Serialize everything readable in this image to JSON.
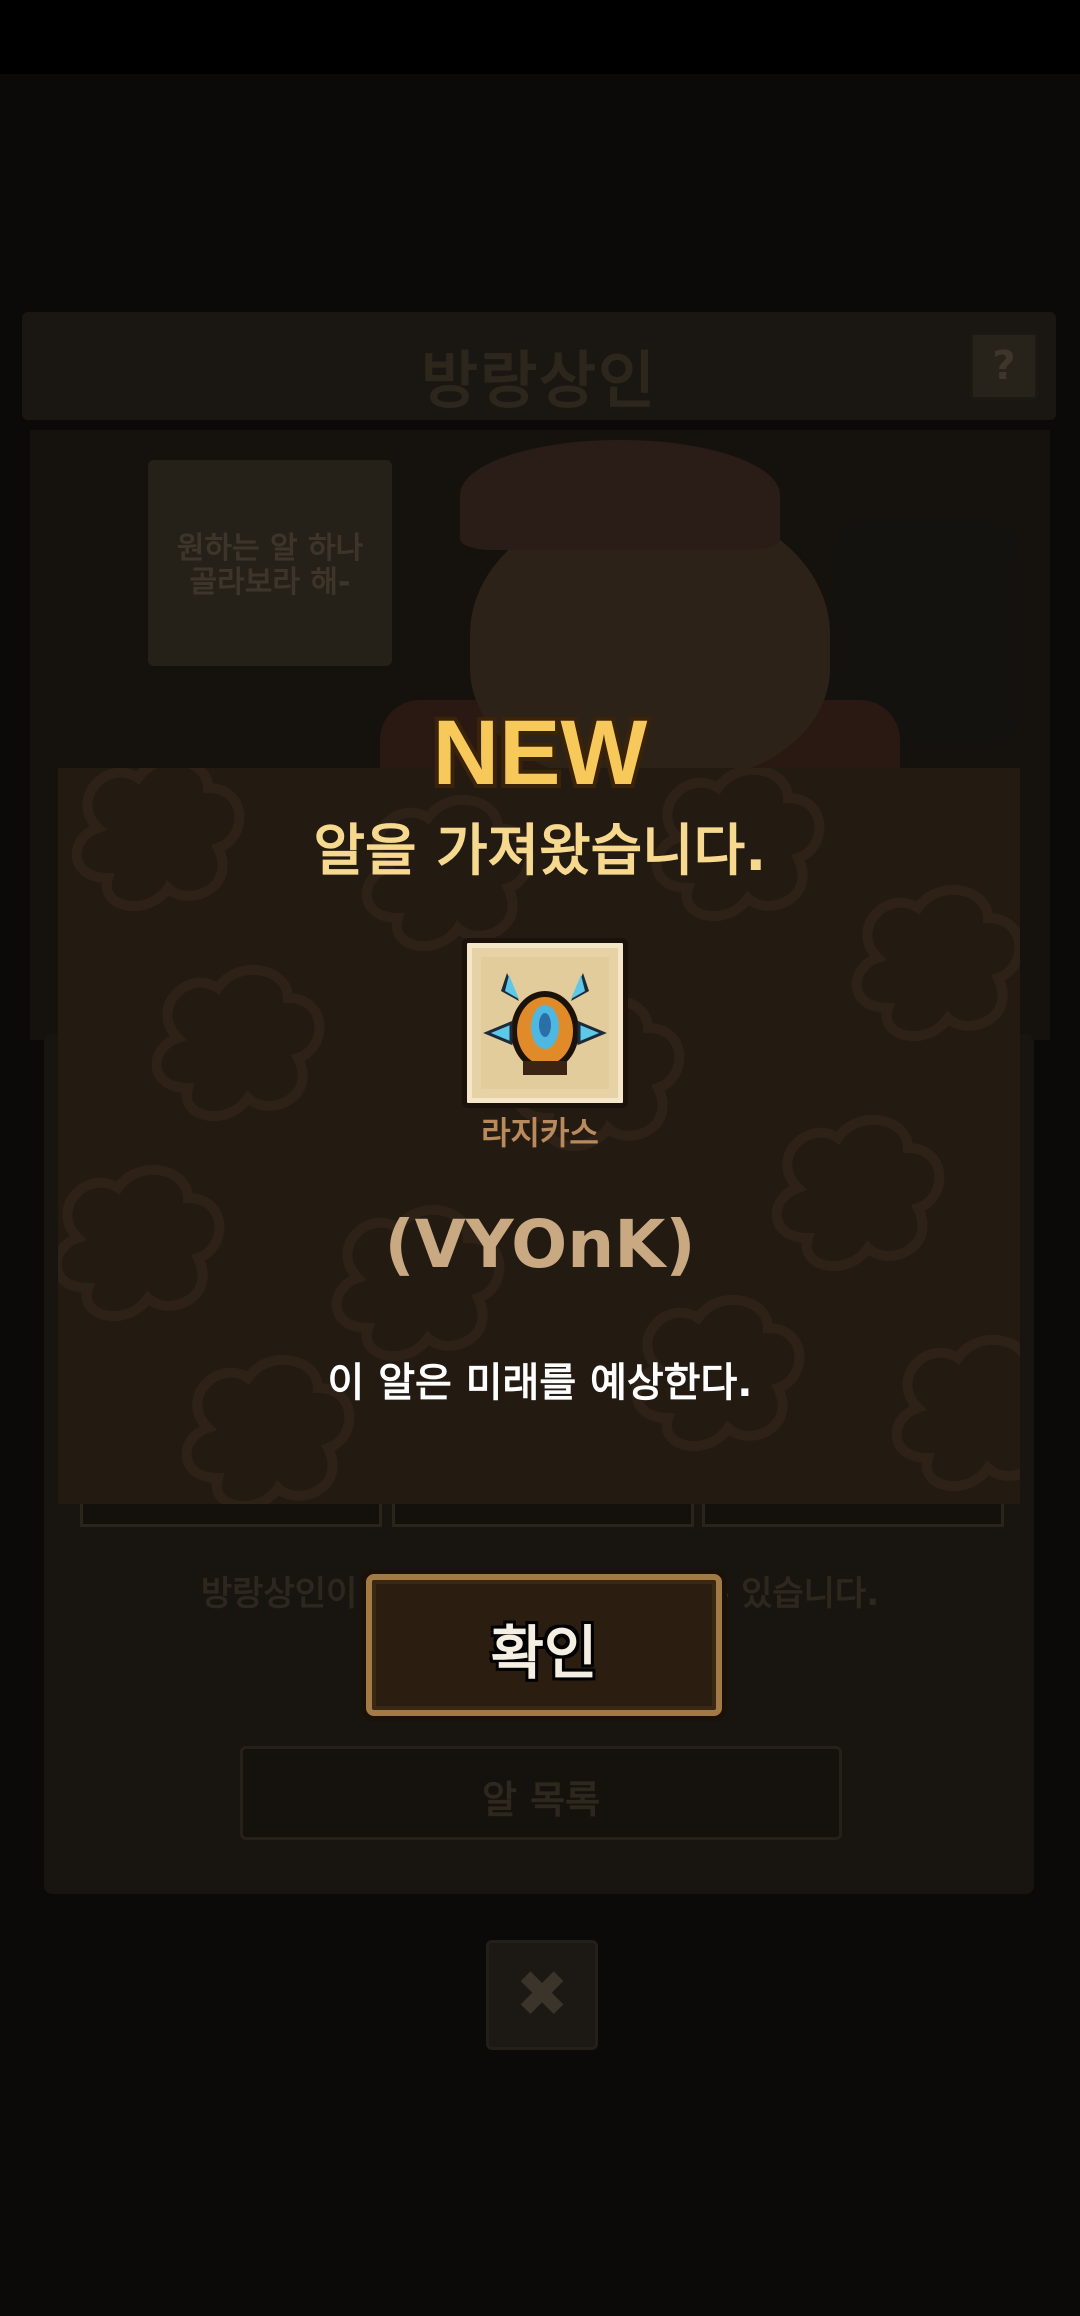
{
  "background": {
    "title": "방랑상인",
    "help_icon": "?",
    "speech_bubble": "원하는 알 하나\n골라보라 해-",
    "note": "방랑상인이 왔을 때만 알을 교환할 수 있습니다.",
    "egg_list_button": "알 목록",
    "close_icon": "✖"
  },
  "modal": {
    "badge": "NEW",
    "heading": "알을 가져왔습니다.",
    "egg_name": "라지카스",
    "egg_code": "(VYOnK)",
    "description": "이 알은 미래를 예상한다.",
    "confirm_label": "확인"
  },
  "colors": {
    "accent_gold": "#f6d98f",
    "modal_bg": "#231a12",
    "button_border": "#a47a44"
  }
}
